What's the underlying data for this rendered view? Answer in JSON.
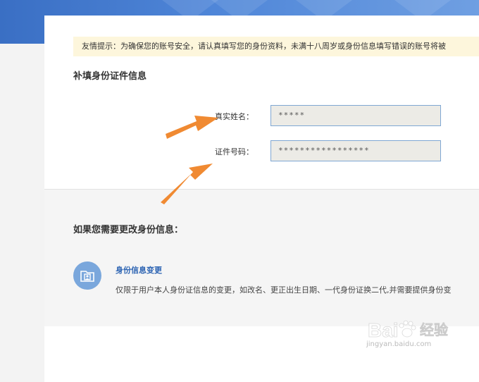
{
  "notice": {
    "text": "友情提示：为确保您的账号安全，请认真填写您的身份资料，未满十八周岁或身份信息填写错误的账号将被"
  },
  "form": {
    "title": "补填身份证件信息",
    "name_label": "真实姓名：",
    "name_value": "*****",
    "id_label": "证件号码：",
    "id_value": "*****************"
  },
  "change": {
    "title": "如果您需要更改身份信息：",
    "item_title": "身份信息变更",
    "item_desc": "仅限于用户本人身份证信息的变更，如改名、更正出生日期、一代身份证换二代,并需要提供身份变"
  },
  "watermark": {
    "logo_text": "Bai 经验",
    "sub_text": "jingyan.baidu.com"
  },
  "colors": {
    "arrow": "#f08a32",
    "accent": "#2d64b3",
    "field_border": "#7fa7d3"
  },
  "icons": [
    "folder-user-icon",
    "arrow-pointer-icon",
    "baidu-paw-icon"
  ]
}
